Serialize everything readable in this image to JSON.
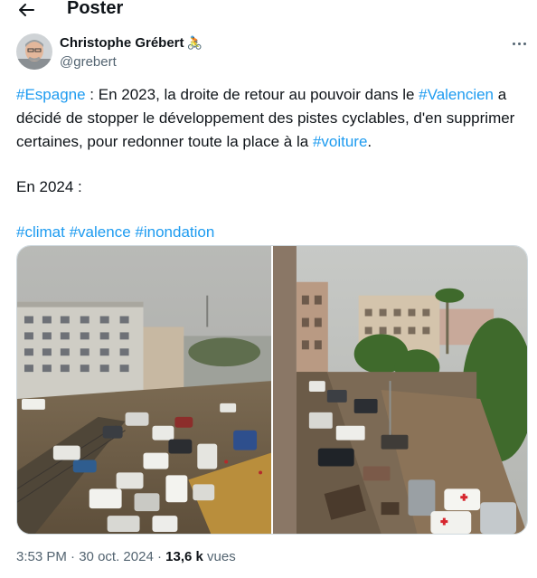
{
  "header": {
    "title": "Poster",
    "back_icon": "arrow-left-icon"
  },
  "author": {
    "name": "Christophe Grébert",
    "badge": "🚴",
    "handle": "@grebert"
  },
  "tweet": {
    "line1_tag": "#Espagne",
    "line1_text": " : En 2023, la droite de retour au pouvoir dans le ",
    "line1_tag2": "#Valencien",
    "line1_text2": " a décidé de stopper le développement des pistes cyclables, d'en supprimer certaines, pour redonner toute la place à la ",
    "line1_tag3": "#voiture",
    "line1_end": ".",
    "line2": "En 2024 :",
    "tags": [
      "#climat",
      "#valence",
      "#inondation"
    ]
  },
  "meta": {
    "time": "3:53 PM",
    "separator": " · ",
    "date": "30 oct. 2024",
    "views_count": "13,6 k",
    "views_label": " vues"
  },
  "colors": {
    "accent": "#1d9bf0",
    "text": "#0f1419",
    "muted": "#536471"
  }
}
